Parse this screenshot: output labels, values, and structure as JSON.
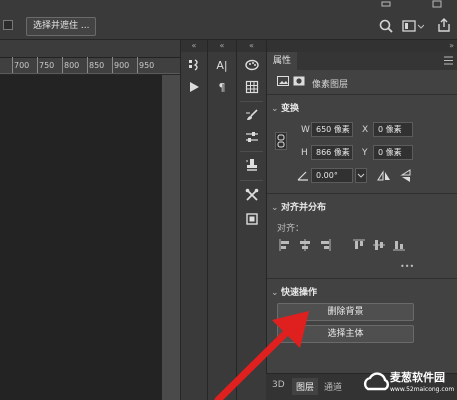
{
  "options_bar": {
    "select_subject_button": "选择并遮住 ..."
  },
  "ruler": {
    "ticks": [
      "700",
      "750",
      "800",
      "850",
      "900",
      "950"
    ]
  },
  "tool_column_2": {
    "char_icon": "A|",
    "para_icon": "¶"
  },
  "properties": {
    "tab_label": "属性",
    "layer_type": "像素图层",
    "transform": {
      "title": "变换",
      "w_label": "W",
      "w_value": "650 像素",
      "x_label": "X",
      "x_value": "0 像素",
      "h_label": "H",
      "h_value": "866 像素",
      "y_label": "Y",
      "y_value": "0 像素",
      "angle_value": "0.00°"
    },
    "align": {
      "title": "对齐并分布",
      "sub_label": "对齐：",
      "more": "•••"
    },
    "quick_actions": {
      "title": "快速操作",
      "remove_bg": "删除背景",
      "select_subject": "选择主体"
    }
  },
  "bottom_tabs": [
    "3D",
    "图层",
    "通道"
  ],
  "watermark": {
    "title": "麦葱软件园",
    "url": "www.52maicong.com"
  },
  "colors": {
    "arrow": "#e0201e",
    "panel": "#424242",
    "canvas": "#232323"
  }
}
